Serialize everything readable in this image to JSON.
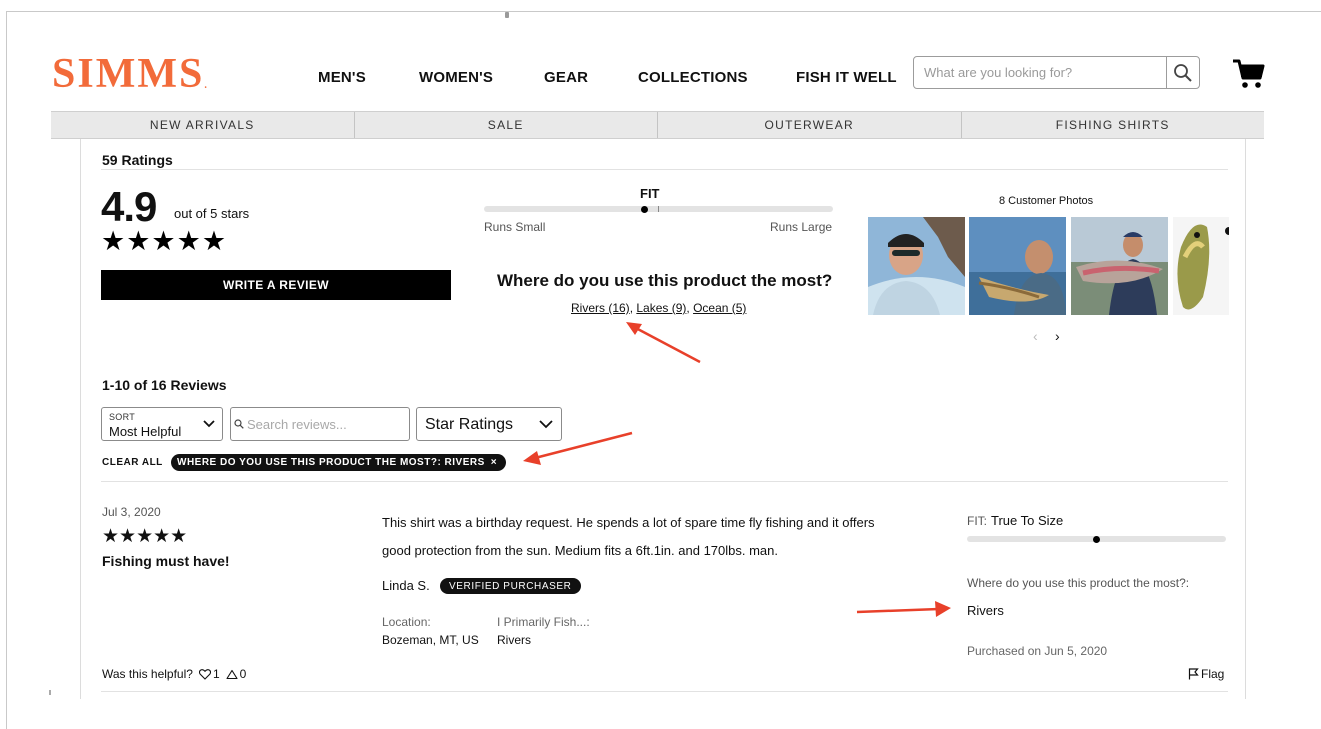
{
  "header": {
    "logo_text": "SIMMS",
    "logo_mark": ".",
    "nav": [
      "MEN'S",
      "WOMEN'S",
      "GEAR",
      "COLLECTIONS",
      "FISH IT WELL"
    ],
    "search_placeholder": "What are you looking for?",
    "search_icon": "magnifier-icon",
    "cart_icon": "cart-icon"
  },
  "subnav": [
    "NEW ARRIVALS",
    "SALE",
    "OUTERWEAR",
    "FISHING SHIRTS"
  ],
  "summary": {
    "ratings_count": "59 Ratings",
    "average": "4.9",
    "out_of": "out of 5 stars",
    "stars": "★★★★★",
    "write_review": "WRITE A REVIEW",
    "fit": {
      "title": "FIT",
      "left_label": "Runs Small",
      "right_label": "Runs Large",
      "position": 0.46
    },
    "where": {
      "question": "Where do you use this product the most?",
      "options": [
        {
          "label": "Rivers (16)",
          "sep": ", "
        },
        {
          "label": "Lakes (9)",
          "sep": ", "
        },
        {
          "label": "Ocean (5)",
          "sep": ""
        }
      ]
    },
    "photos_title": "8 Customer Photos",
    "photo_prev": "‹",
    "photo_next": "›"
  },
  "filters": {
    "reviews_count": "1-10 of 16 Reviews",
    "sort_label": "SORT",
    "sort_value": "Most Helpful",
    "search_placeholder": "Search reviews...",
    "star_ratings": "Star Ratings",
    "clear_all": "CLEAR ALL",
    "active_filter": "WHERE DO YOU USE THIS PRODUCT THE MOST?: RIVERS",
    "remove": "×"
  },
  "review": {
    "date": "Jul 3, 2020",
    "stars": "★★★★★",
    "title": "Fishing must have!",
    "body_line1": "This shirt was a birthday request. He spends a lot of spare time fly fishing and it offers",
    "body_line2": "good protection from the sun. Medium fits a 6ft.1in. and 170lbs. man.",
    "author": "Linda S.",
    "badge": "VERIFIED PURCHASER",
    "location_label": "Location:",
    "location_value": "Bozeman, MT, US",
    "fish_label": "I Primarily Fish...:",
    "fish_value": "Rivers",
    "fit_label": "FIT:",
    "fit_value": "True To Size",
    "fit_position": 0.5,
    "where_q": "Where do you use this product the most?:",
    "where_a": "Rivers",
    "purchased": "Purchased on Jun 5, 2020",
    "helpful_label": "Was this helpful?",
    "up_count": "1",
    "down_count": "0",
    "flag": "Flag"
  },
  "colors": {
    "brand": "#f26b3a",
    "annotation": "#e8402a"
  }
}
